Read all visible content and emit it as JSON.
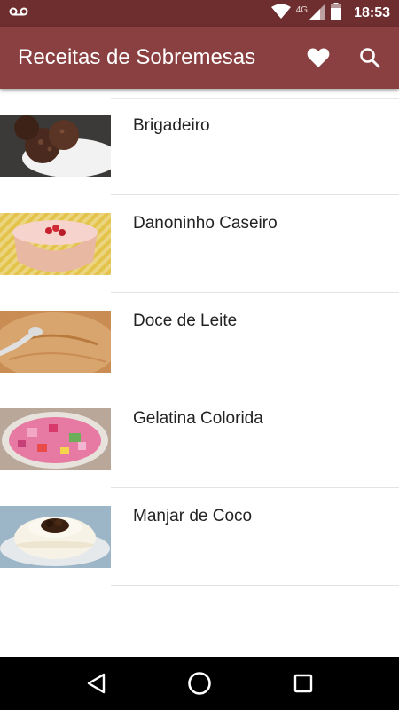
{
  "status_bar": {
    "time": "18:53",
    "network": "4G",
    "icons": [
      "voicemail-icon",
      "wifi-icon",
      "signal-icon",
      "battery-icon"
    ]
  },
  "app_bar": {
    "title": "Receitas de Sobremesas",
    "actions": [
      "favorites-heart-icon",
      "search-icon"
    ],
    "color": "#8a3f41"
  },
  "recipes": [
    {
      "name": "Brigadeiro",
      "thumb": "chocolate-truffles"
    },
    {
      "name": "Danoninho Caseiro",
      "thumb": "strawberry-yogurt"
    },
    {
      "name": "Doce de Leite",
      "thumb": "caramel-spread"
    },
    {
      "name": "Gelatina Colorida",
      "thumb": "colorful-gelatin"
    },
    {
      "name": "Manjar de Coco",
      "thumb": "coconut-pudding"
    }
  ],
  "nav_bar": {
    "buttons": [
      "back-icon",
      "home-icon",
      "recent-apps-icon"
    ]
  }
}
